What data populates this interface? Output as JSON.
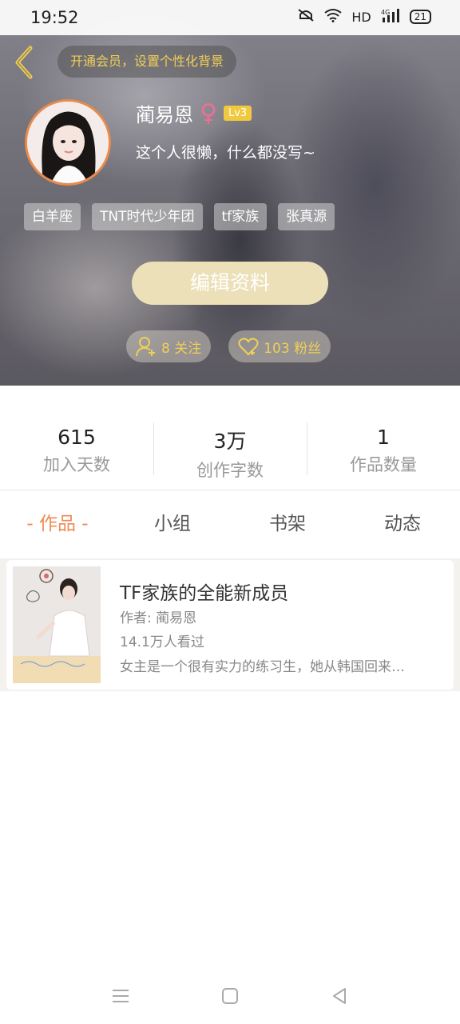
{
  "status_bar": {
    "time": "19:52",
    "network": "HD",
    "battery": "21"
  },
  "header": {
    "vip_banner": "开通会员，设置个性化背景",
    "username": "蔺易恩",
    "gender_symbol": "♀",
    "level": "Lv3",
    "bio": "这个人很懒，什么都没写~",
    "tags": [
      "白羊座",
      "TNT时代少年团",
      "tf家族",
      "张真源"
    ],
    "edit_button": "编辑资料",
    "following": "8 关注",
    "fans": "103 粉丝"
  },
  "stats": [
    {
      "value": "615",
      "label": "加入天数"
    },
    {
      "value": "3万",
      "label": "创作字数"
    },
    {
      "value": "1",
      "label": "作品数量"
    }
  ],
  "tabs": [
    "- 作品 -",
    "小组",
    "书架",
    "动态"
  ],
  "works": [
    {
      "title": "TF家族的全能新成员",
      "author": "作者: 蔺易恩",
      "views": "14.1万人看过",
      "description": "女主是一个很有实力的练习生，她从韩国回来…"
    }
  ],
  "colors": {
    "accent": "#ee8a53",
    "gold": "#f0cf58",
    "edit_button_bg": "#ece0b8"
  }
}
